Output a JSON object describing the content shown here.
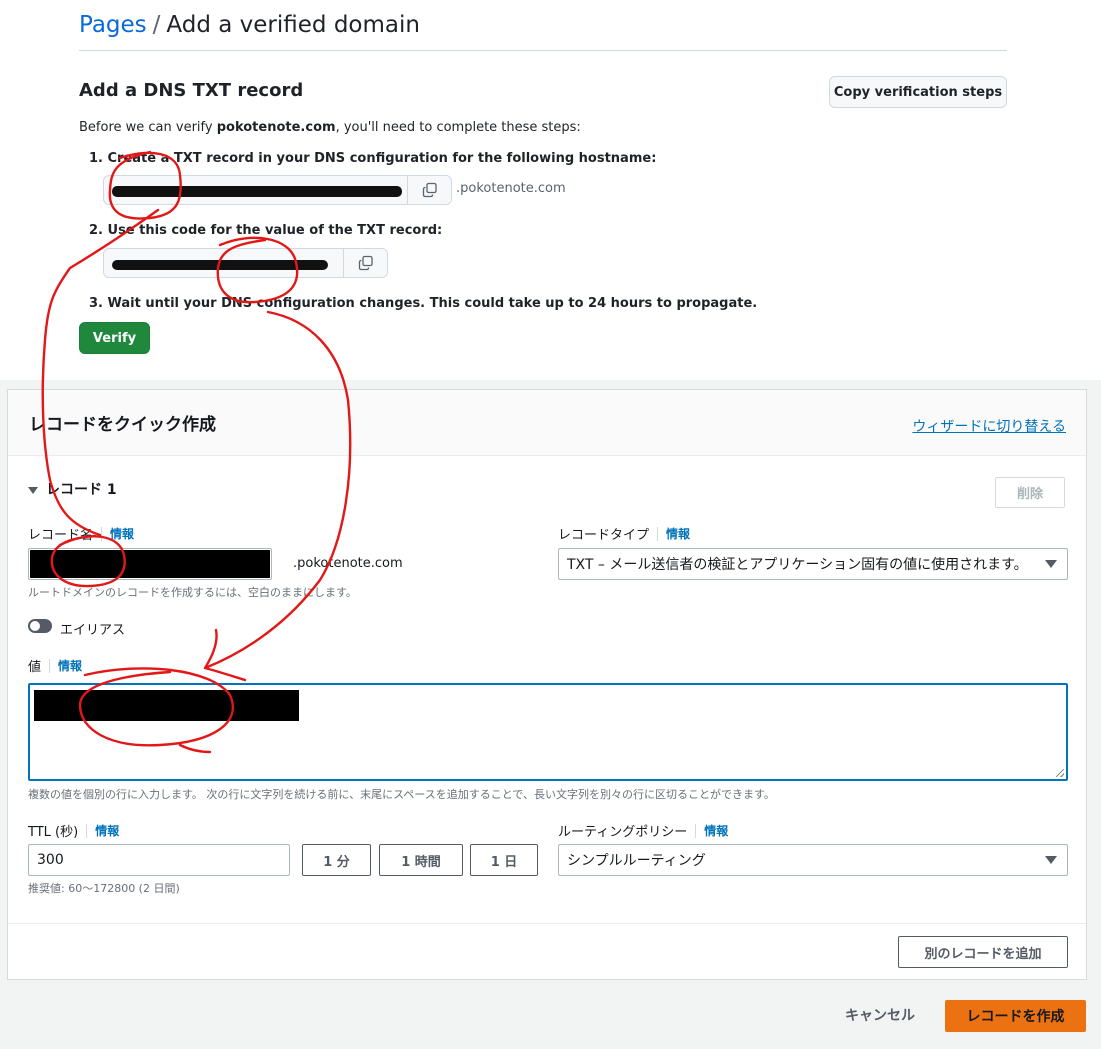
{
  "github": {
    "breadcrumb": {
      "link": "Pages",
      "separator": "/",
      "current": "Add a verified domain"
    },
    "section_title": "Add a DNS TXT record",
    "copy_steps_label": "Copy verification steps",
    "intro": {
      "before": "Before we can verify ",
      "domain": "pokotenote.com",
      "after": ", you'll need to complete these steps:"
    },
    "steps": [
      "1. Create a TXT record in your DNS configuration for the following hostname:",
      "2. Use this code for the value of the TXT record:",
      "3. Wait until your DNS configuration changes. This could take up to 24 hours to propagate."
    ],
    "hostname_suffix": ".pokotenote.com",
    "verify_label": "Verify",
    "icons": {
      "copy": "copy-icon"
    }
  },
  "aws": {
    "panel_title": "レコードをクイック作成",
    "wizard_link": "ウィザードに切り替える",
    "record_heading": "レコード 1",
    "delete_label": "削除",
    "info_label": "情報",
    "record_name": {
      "label": "レコード名",
      "suffix": ".pokotenote.com",
      "hint": "ルートドメインのレコードを作成するには、空白のままにします。"
    },
    "record_type": {
      "label": "レコードタイプ",
      "selected": "TXT – メール送信者の検証とアプリケーション固有の値に使用されます。"
    },
    "alias_label": "エイリアス",
    "value": {
      "label": "値",
      "hint": "複数の値を個別の行に入力します。 次の行に文字列を続ける前に、末尾にスペースを追加することで、長い文字列を別々の行に区切ることができます。"
    },
    "ttl": {
      "label": "TTL (秒)",
      "value": "300",
      "presets": [
        "1 分",
        "1 時間",
        "1 日"
      ],
      "hint": "推奨値: 60〜172800 (2 日間)"
    },
    "routing": {
      "label": "ルーティングポリシー",
      "selected": "シンプルルーティング"
    },
    "add_record_label": "別のレコードを追加",
    "cancel_label": "キャンセル",
    "create_label": "レコードを作成"
  },
  "colors": {
    "github_link": "#0969da",
    "github_green": "#1f883d",
    "aws_orange": "#ec7211",
    "aws_link": "#0073bb",
    "annotation_red": "#e21818"
  }
}
